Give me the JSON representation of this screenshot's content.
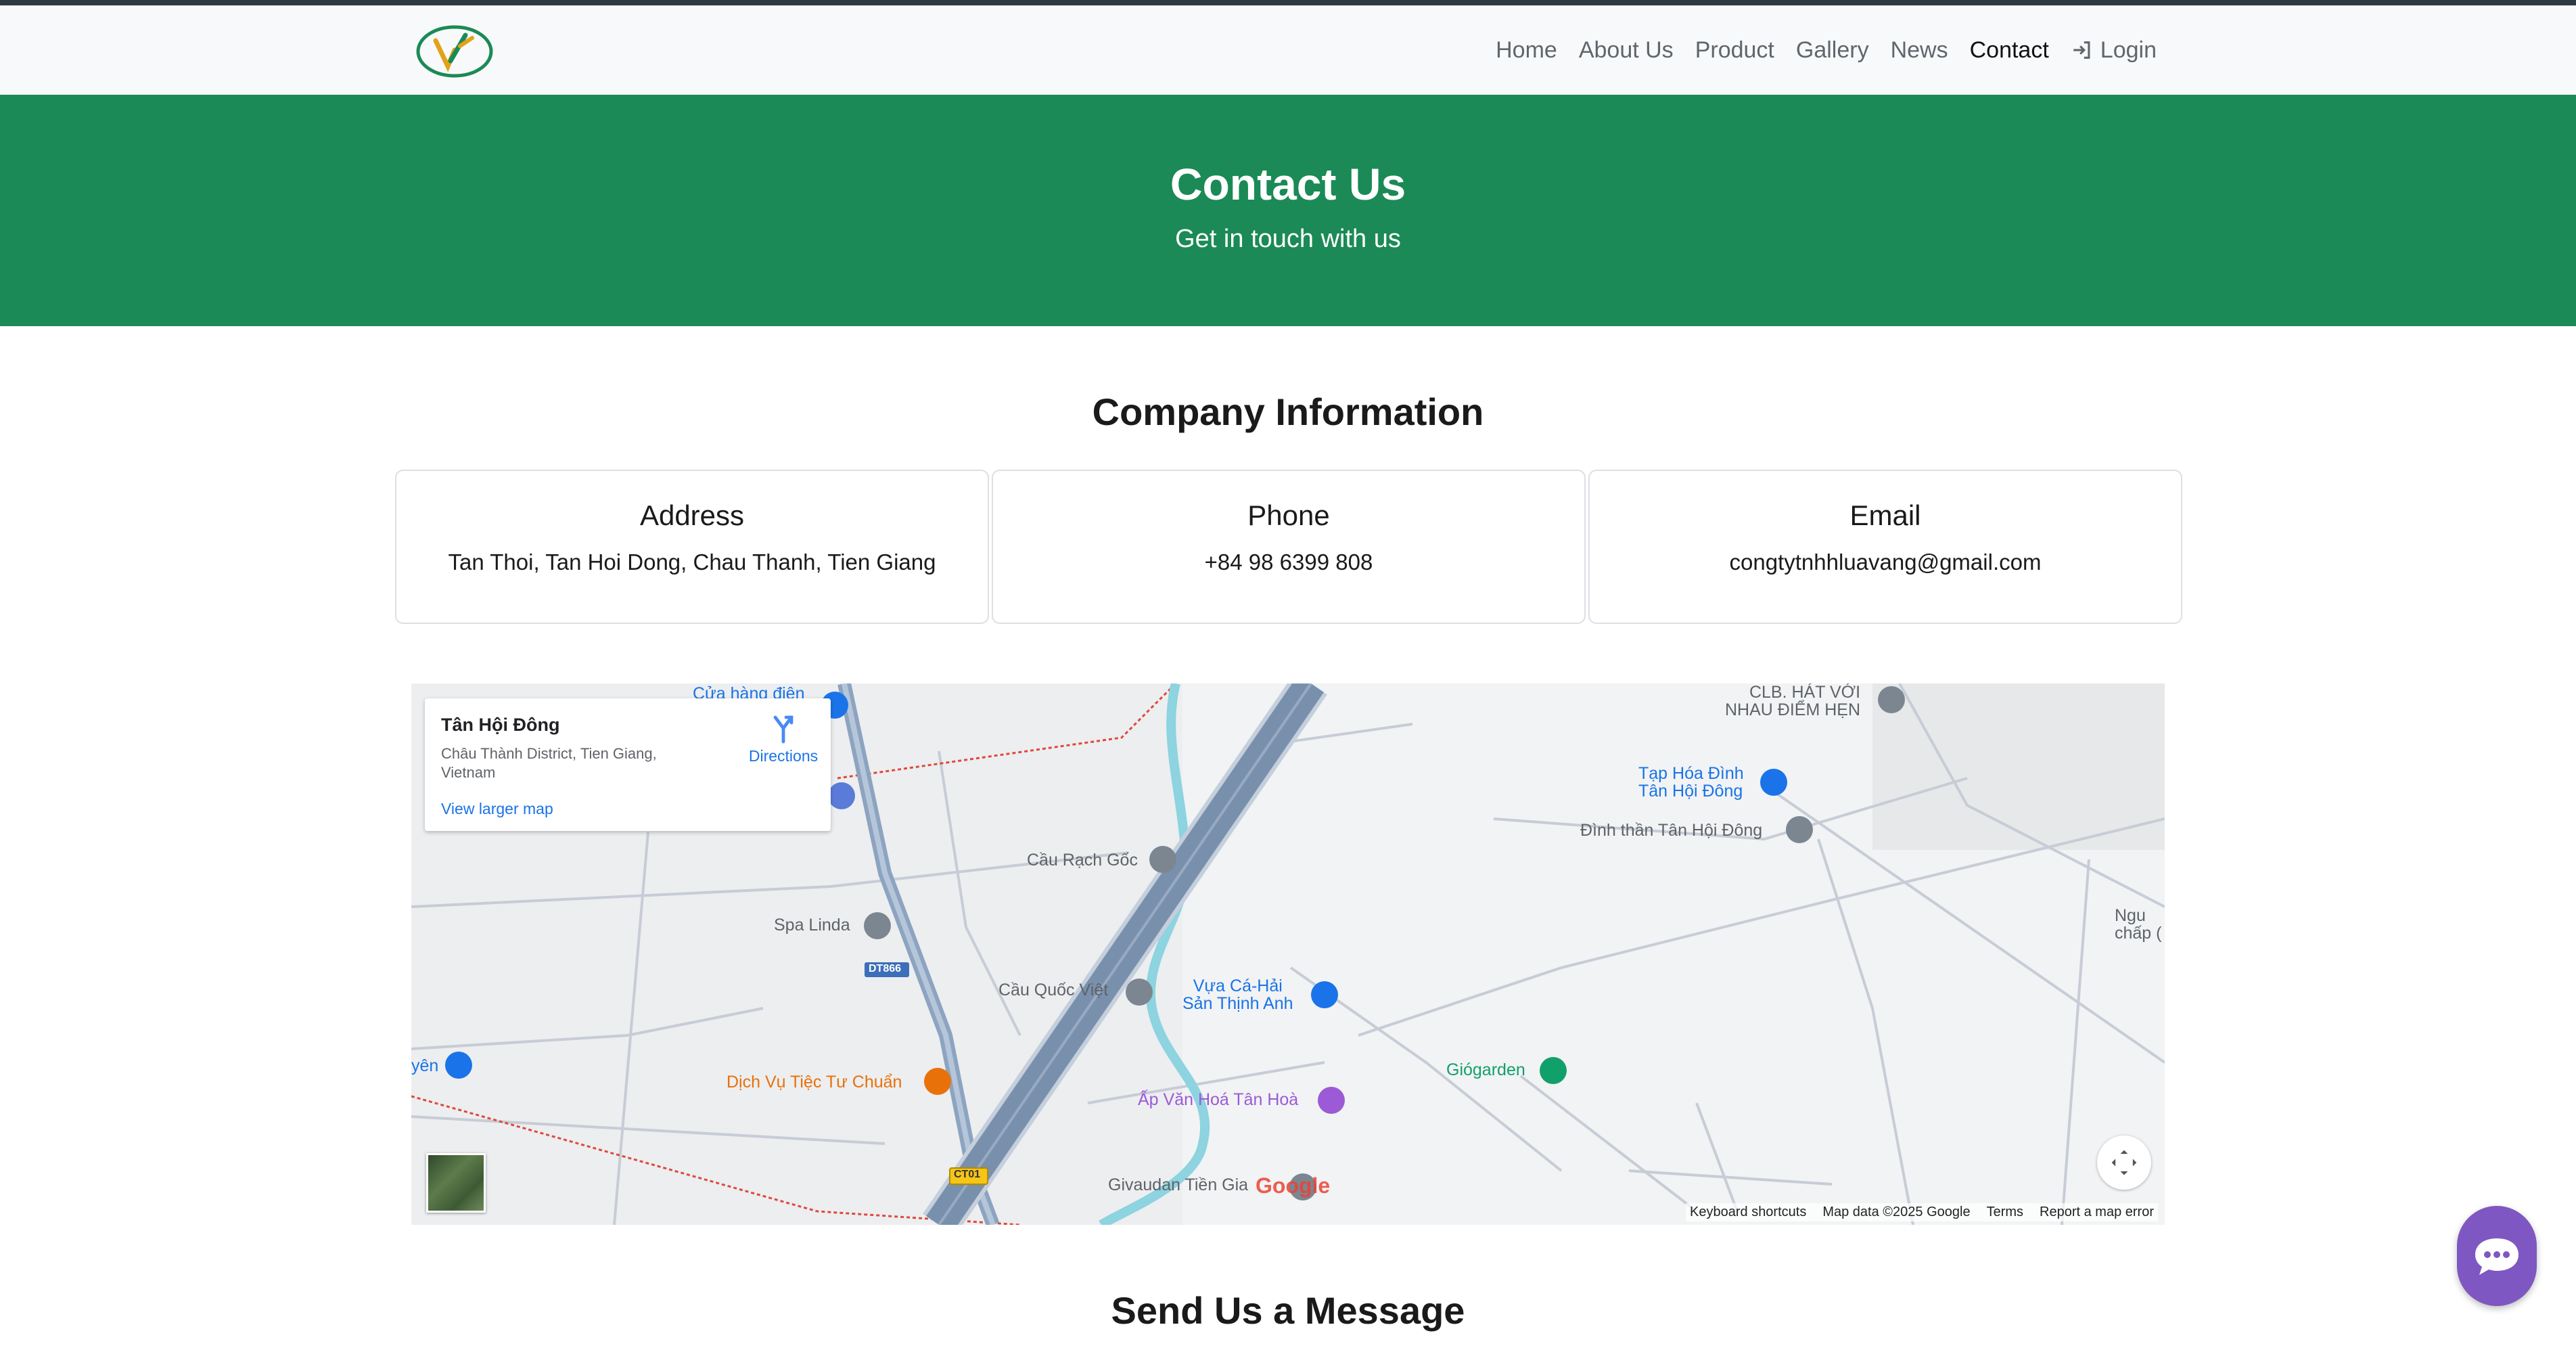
{
  "nav": {
    "items": [
      {
        "label": "Home"
      },
      {
        "label": "About Us"
      },
      {
        "label": "Product"
      },
      {
        "label": "Gallery"
      },
      {
        "label": "News"
      },
      {
        "label": "Contact",
        "active": true
      }
    ],
    "login": "Login"
  },
  "hero": {
    "title": "Contact Us",
    "subtitle": "Get in touch with us"
  },
  "company": {
    "title": "Company Information",
    "cards": [
      {
        "title": "Address",
        "value": "Tan Thoi, Tan Hoi Dong, Chau Thanh, Tien Giang"
      },
      {
        "title": "Phone",
        "value": "+84 98 6399 808"
      },
      {
        "title": "Email",
        "value": "congtytnhhluavang@gmail.com"
      }
    ]
  },
  "map": {
    "place_name": "Tân Hội Đông",
    "place_address": "Châu Thành District, Tien Giang, Vietnam",
    "directions": "Directions",
    "larger_map": "View larger map",
    "labels": {
      "cua_hang": "Cửa hàng điện",
      "clb": "CLB. HÁT VỚI\nNHAU ĐIỂM HẸN",
      "tap_hoa": "Tạp Hóa Đình\nTân Hội Đông",
      "dinh_than": "Đình thần Tân Hội Đông",
      "cau_rach_goc": "Cầu Rạch Gốc",
      "spa_linda": "Spa Linda",
      "dt866": "DT866",
      "nguc": "Ngu\nchấp (",
      "cau_quoc_viet": "Cầu Quốc Việt",
      "vua_ca": "Vựa Cá-Hải\nSản Thịnh Anh",
      "yen": "yên",
      "dich_vu": "Dịch Vụ Tiệc Tư Chuẩn",
      "giogarden": "Giógarden",
      "ap_van_hoa": "Ấp Văn Hoá Tân Hoà",
      "ct01": "CT01",
      "givaudan": "Givaudan Tiền Gia"
    },
    "google": "Google",
    "footer": {
      "shortcuts": "Keyboard shortcuts",
      "data": "Map data ©2025 Google",
      "terms": "Terms",
      "report": "Report a map error"
    }
  },
  "message": {
    "title": "Send Us a Message"
  },
  "colors": {
    "hero_green": "#1b8a56",
    "chat_purple": "#7e57c2"
  }
}
